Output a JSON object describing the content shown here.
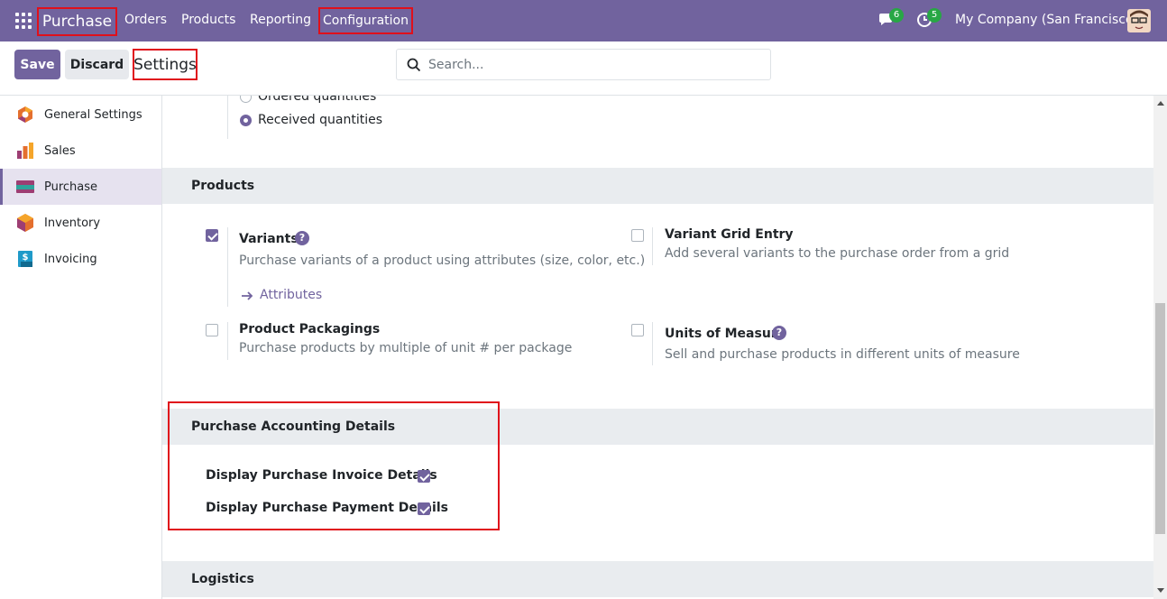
{
  "navbar": {
    "brand": "Purchase",
    "menu": [
      "Orders",
      "Products",
      "Reporting"
    ],
    "config": "Configuration",
    "messages_count": "6",
    "activities_count": "5",
    "company": "My Company (San Francisco)"
  },
  "control_panel": {
    "save_label": "Save",
    "discard_label": "Discard",
    "breadcrumb": "Settings",
    "search_placeholder": "Search..."
  },
  "sidebar": {
    "items": [
      {
        "label": "General Settings",
        "icon": "odoo-logo-icon"
      },
      {
        "label": "Sales",
        "icon": "sales-chart-icon"
      },
      {
        "label": "Purchase",
        "icon": "purchase-card-icon",
        "active": true
      },
      {
        "label": "Inventory",
        "icon": "inventory-box-icon"
      },
      {
        "label": "Invoicing",
        "icon": "invoicing-doc-icon"
      }
    ]
  },
  "bill_control": {
    "ordered": "Ordered quantities",
    "received": "Received quantities"
  },
  "products": {
    "title": "Products",
    "variants_title": "Variants",
    "variants_desc": "Purchase variants of a product using attributes (size, color, etc.)",
    "attributes_link": "Attributes",
    "variant_grid_title": "Variant Grid Entry",
    "variant_grid_desc": "Add several variants to the purchase order from a grid",
    "packagings_title": "Product Packagings",
    "packagings_desc": "Purchase products by multiple of unit # per package",
    "uom_title": "Units of Measure",
    "uom_desc": "Sell and purchase products in different units of measure"
  },
  "accounting": {
    "title": "Purchase Accounting Details",
    "invoice_label": "Display Purchase Invoice Details",
    "payment_label": "Display Purchase Payment Details"
  },
  "logistics": {
    "title": "Logistics"
  },
  "colors": {
    "brand": "#71639e",
    "highlight": "#e0101b",
    "badge": "#28a745"
  }
}
